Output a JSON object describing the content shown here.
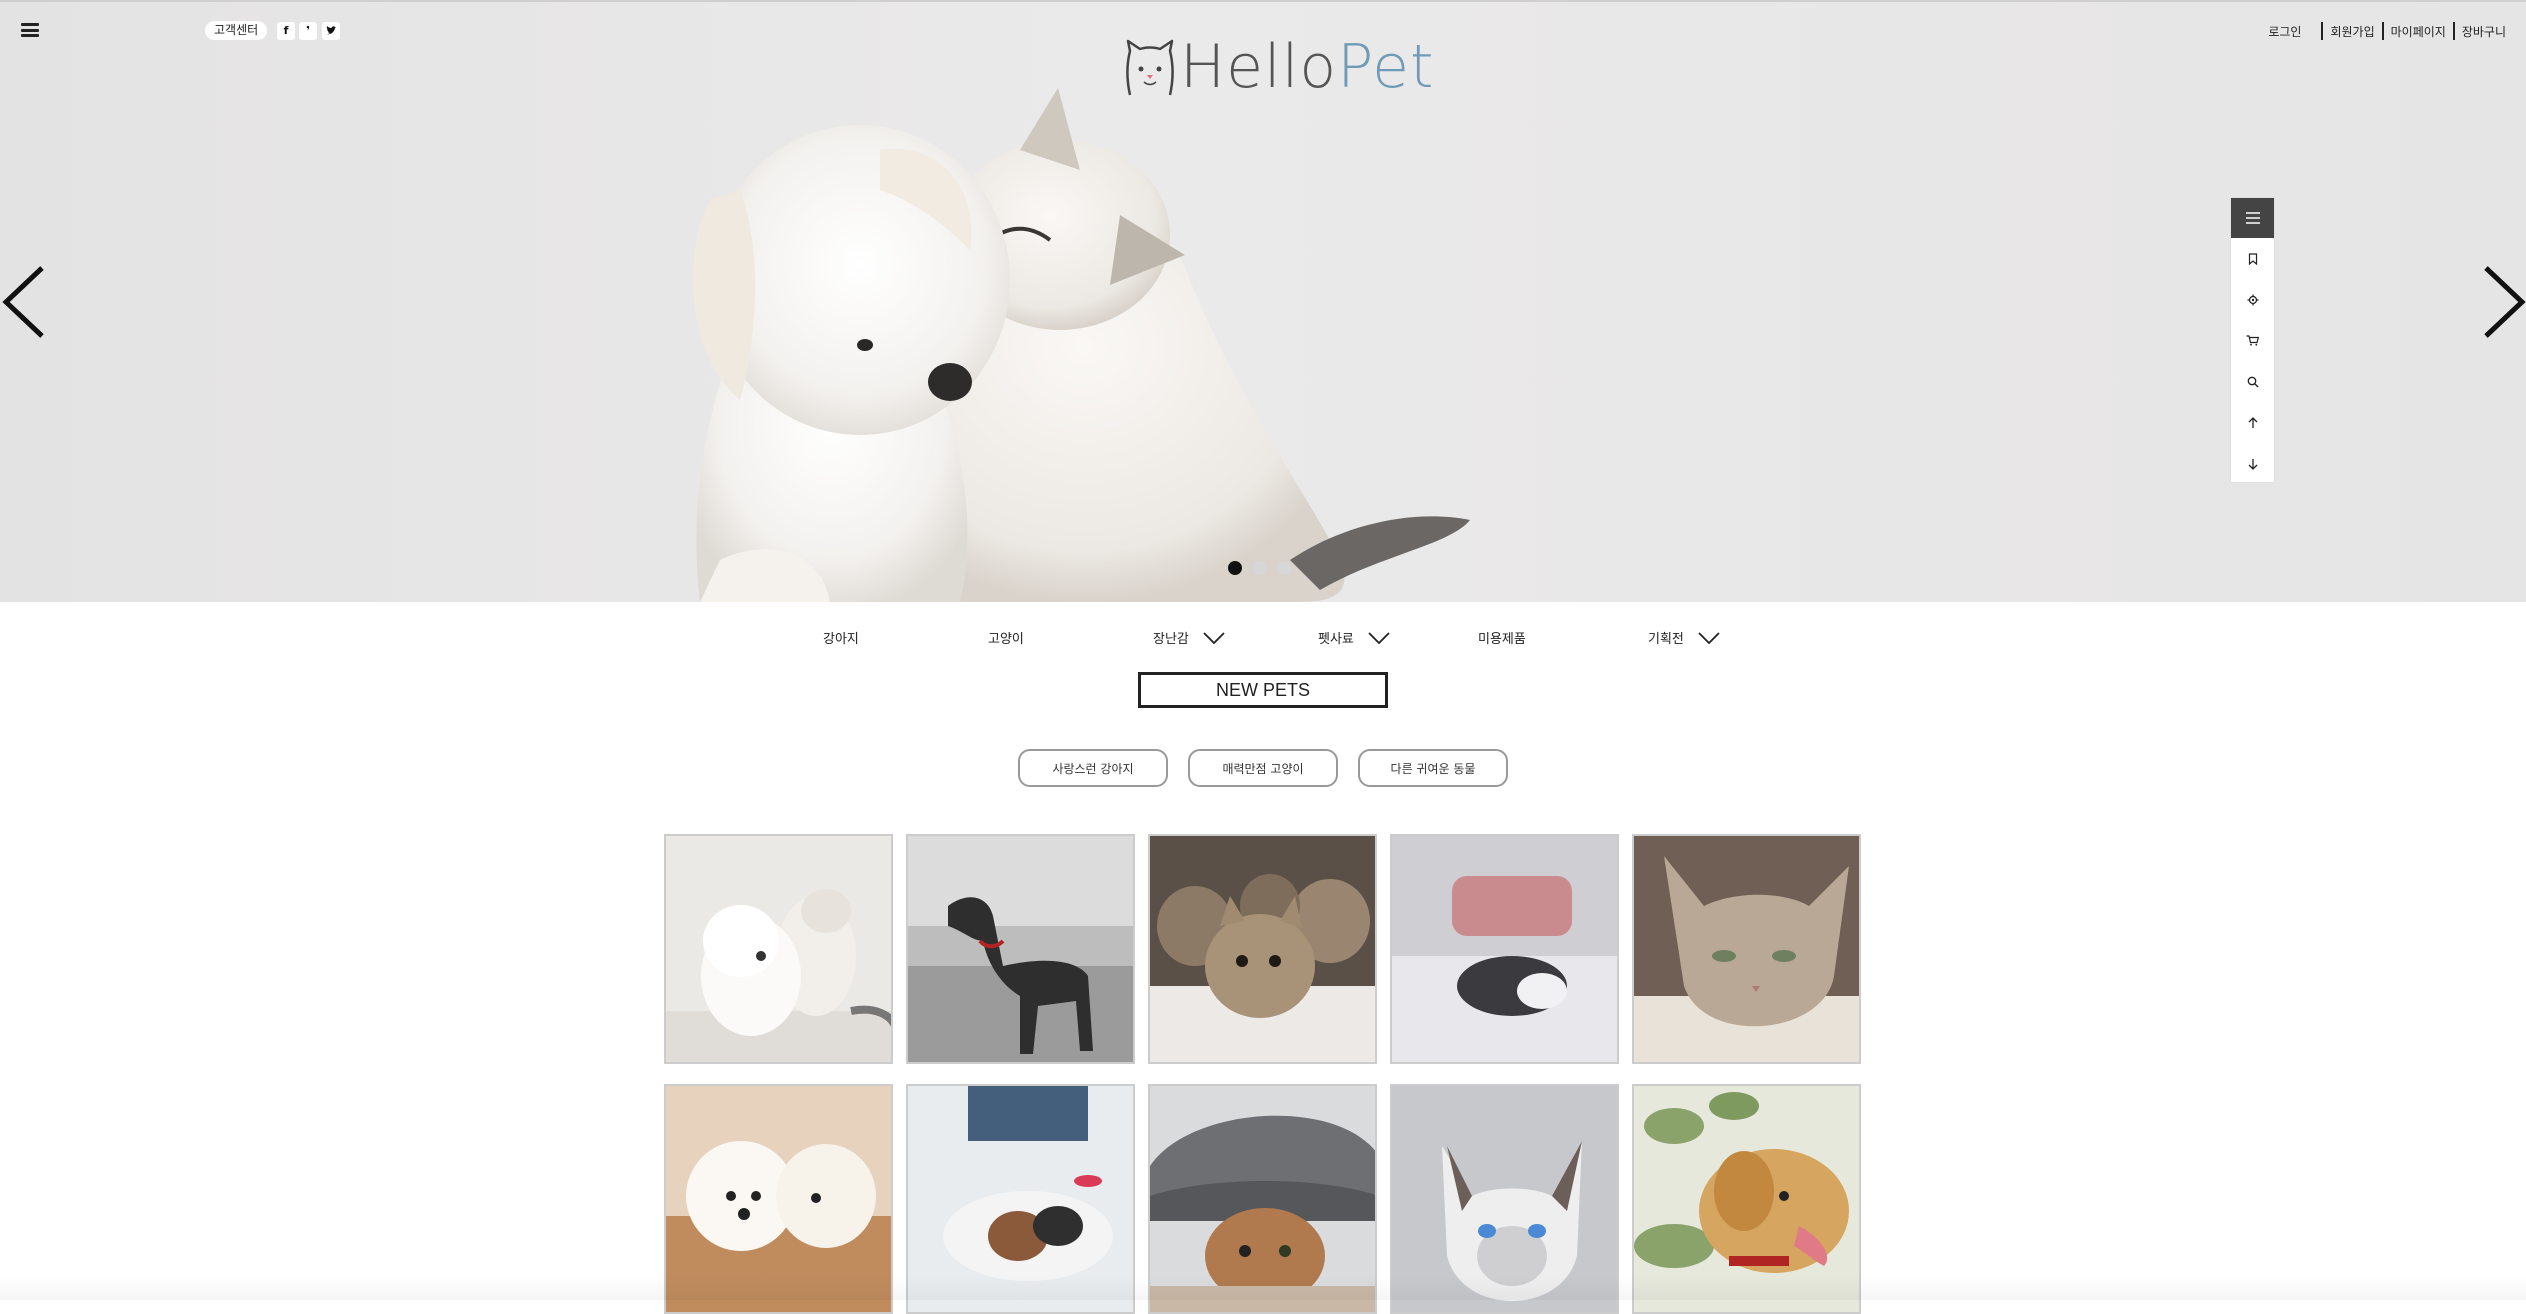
{
  "header": {
    "menu_icon": "hamburger-icon",
    "customer_center": "고객센터",
    "sns": [
      {
        "icon": "facebook-icon",
        "glyph": "f"
      },
      {
        "icon": "kakaostory-icon",
        "glyph": "❜"
      },
      {
        "icon": "twitter-icon",
        "glyph": "🐦"
      }
    ],
    "logo": {
      "part1": "Hello",
      "part2": "Pet"
    },
    "links": [
      "로그인",
      "회원가입",
      "마이페이지",
      "장바구니"
    ]
  },
  "slider": {
    "prev_icon": "chevron-left-icon",
    "next_icon": "chevron-right-icon",
    "dots": 3,
    "active_dot": 0
  },
  "quickbar": [
    "menu-icon",
    "bookmark-icon",
    "gear-icon",
    "cart-icon",
    "search-icon",
    "arrow-up-icon",
    "arrow-down-icon"
  ],
  "nav": [
    {
      "label": "강아지",
      "dropdown": false
    },
    {
      "label": "고양이",
      "dropdown": false
    },
    {
      "label": "장난감",
      "dropdown": true
    },
    {
      "label": "펫사료",
      "dropdown": true
    },
    {
      "label": "미용제품",
      "dropdown": false
    },
    {
      "label": "기획전",
      "dropdown": true
    }
  ],
  "section_title": "NEW PETS",
  "filters": [
    "사랑스런 강아지",
    "매력만점 고양이",
    "다른 귀여운 동물"
  ],
  "colors": {
    "accent": "#6f9ab8",
    "dark": "#222222",
    "hero_bg": "#e8e7e7"
  }
}
